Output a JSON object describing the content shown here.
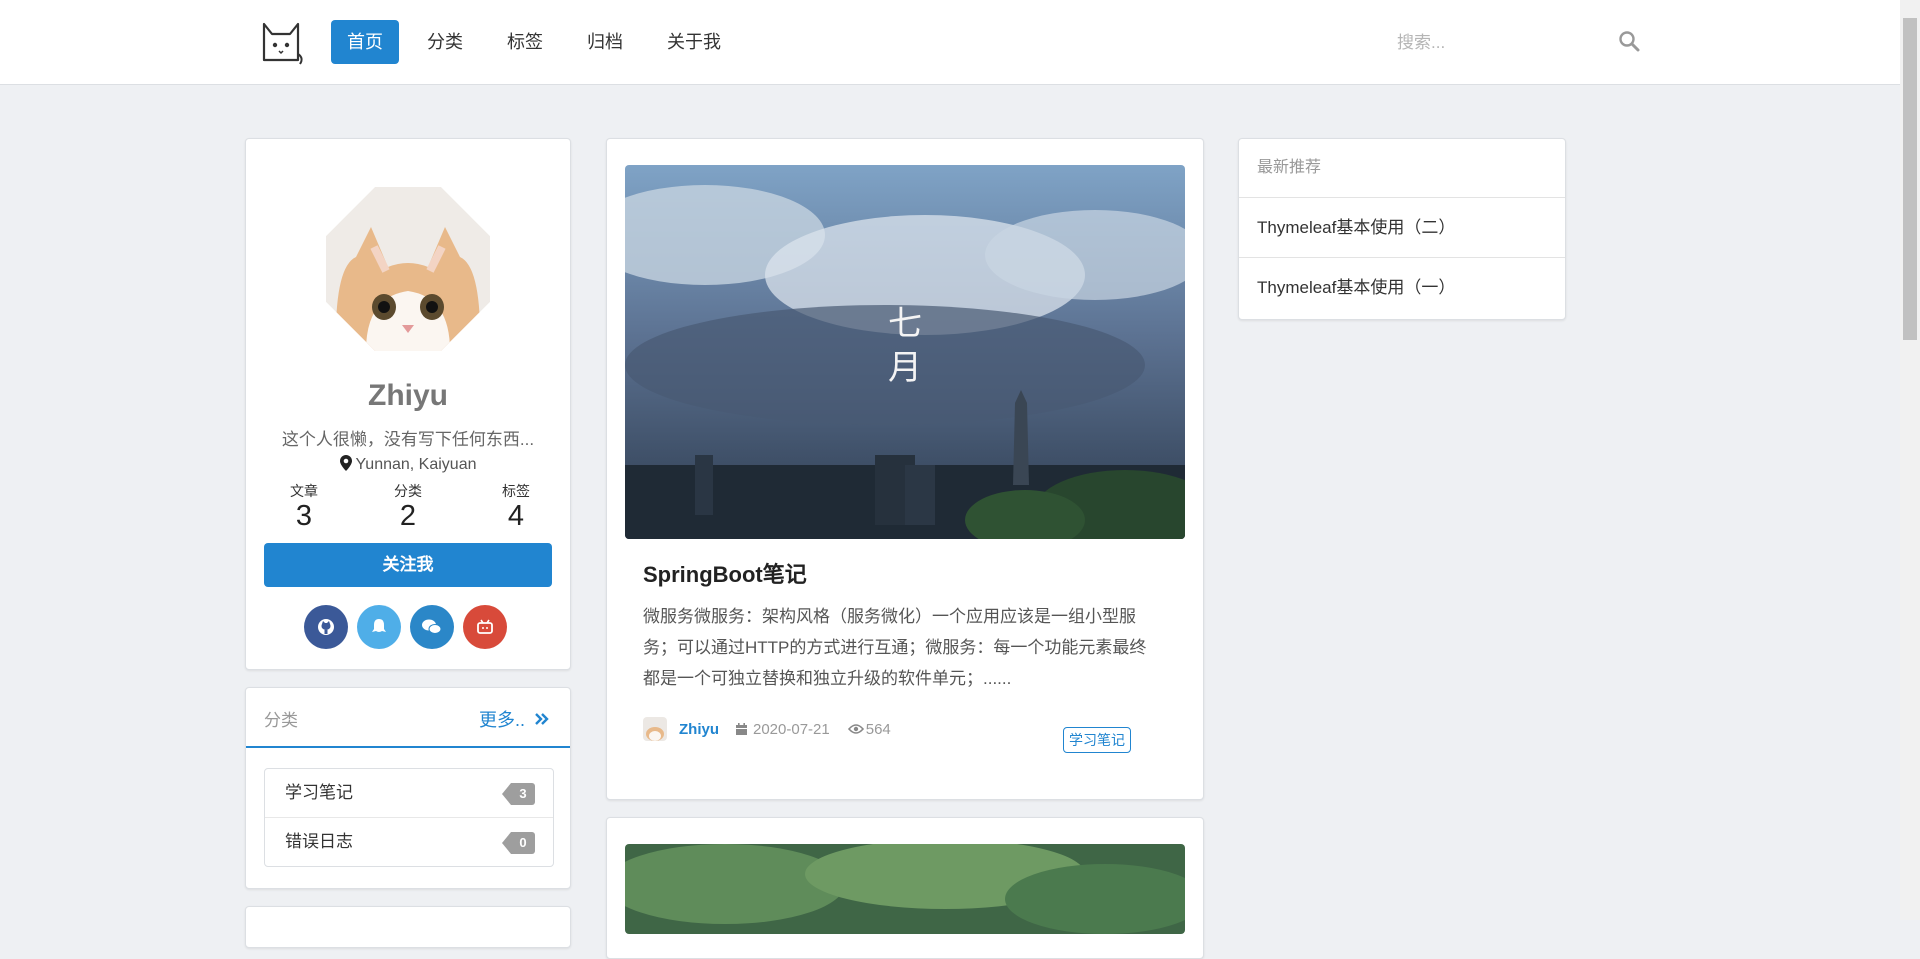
{
  "nav": {
    "items": [
      {
        "label": "首页",
        "active": true
      },
      {
        "label": "分类",
        "active": false
      },
      {
        "label": "标签",
        "active": false
      },
      {
        "label": "归档",
        "active": false
      },
      {
        "label": "关于我",
        "active": false
      }
    ],
    "search_placeholder": "搜索...",
    "logo_icon": "cat-logo-icon"
  },
  "profile": {
    "name": "Zhiyu",
    "bio": "这个人很懒，没有写下任何东西...",
    "location": "Yunnan, Kaiyuan",
    "stats": [
      {
        "label": "文章",
        "value": "3"
      },
      {
        "label": "分类",
        "value": "2"
      },
      {
        "label": "标签",
        "value": "4"
      }
    ],
    "follow_label": "关注我",
    "socials": [
      {
        "name": "github-icon",
        "color": "#3b5998"
      },
      {
        "name": "qq-icon",
        "color": "#4faee8"
      },
      {
        "name": "wechat-icon",
        "color": "#2b87c8"
      },
      {
        "name": "bilibili-icon",
        "color": "#d84a3a"
      }
    ]
  },
  "categories": {
    "title": "分类",
    "more_label": "更多..",
    "items": [
      {
        "label": "学习笔记",
        "count": "3"
      },
      {
        "label": "错误日志",
        "count": "0"
      }
    ]
  },
  "post": {
    "image_caption": "七\n月",
    "title": "SpringBoot笔记",
    "excerpt": "微服务微服务：架构风格（服务微化）一个应用应该是一组小型服务；可以通过HTTP的方式进行互通；微服务：每一个功能元素最终都是一个可独立替换和独立升级的软件单元；......",
    "author": "Zhiyu",
    "date": "2020-07-21",
    "views": "564",
    "tag": "学习笔记"
  },
  "recommend": {
    "title": "最新推荐",
    "items": [
      "Thymeleaf基本使用（二）",
      "Thymeleaf基本使用（一）"
    ]
  },
  "colors": {
    "accent": "#2185d0",
    "background": "#eef0f3"
  }
}
